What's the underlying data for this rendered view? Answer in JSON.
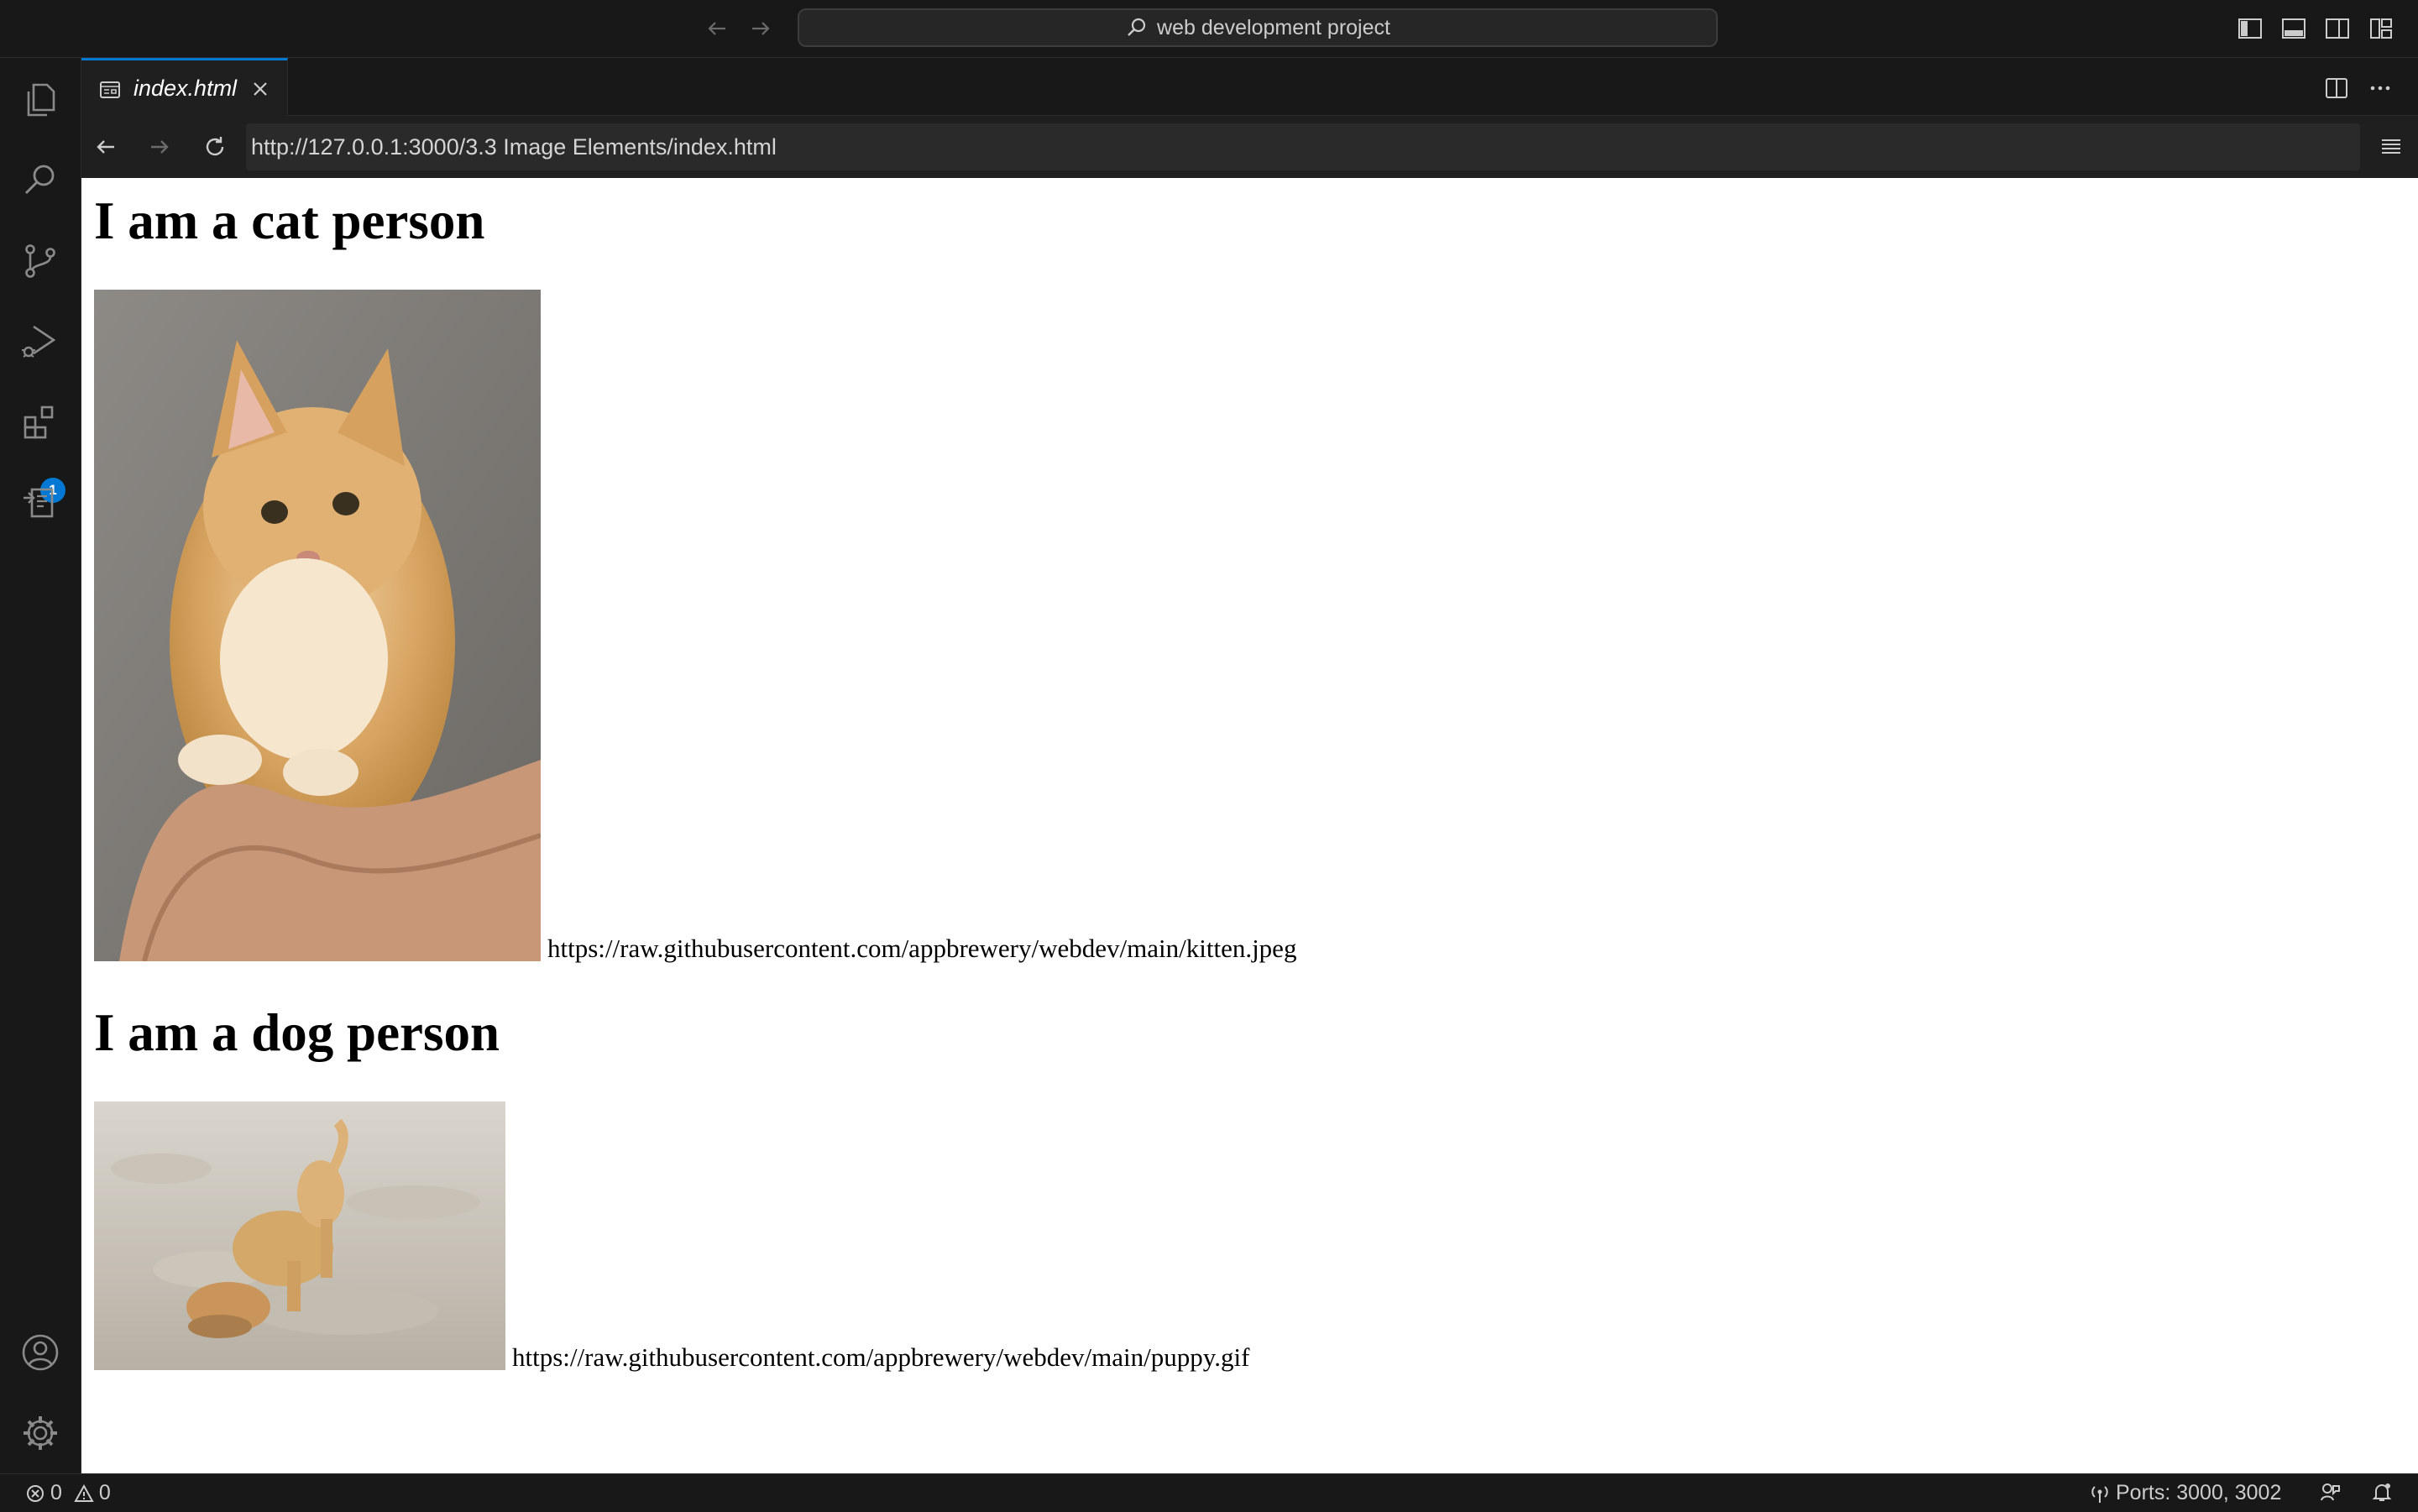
{
  "titlebar": {
    "search_label": "web development project"
  },
  "activitybar": {
    "items": [
      {
        "name": "explorer"
      },
      {
        "name": "search"
      },
      {
        "name": "source-control"
      },
      {
        "name": "run-and-debug"
      },
      {
        "name": "extensions",
        "badge": "1"
      },
      {
        "name": "remote-explorer"
      }
    ]
  },
  "tabs": [
    {
      "label": "index.html",
      "active": true
    }
  ],
  "browser": {
    "url": "http://127.0.0.1:3000/3.3 Image Elements/index.html"
  },
  "page": {
    "heading1": "I am a cat person",
    "image1_url_text": "https://raw.githubusercontent.com/appbrewery/webdev/main/kitten.jpeg",
    "heading2": "I am a dog person",
    "image2_url_text": "https://raw.githubusercontent.com/appbrewery/webdev/main/puppy.gif"
  },
  "statusbar": {
    "errors": "0",
    "warnings": "0",
    "ports": "Ports: 3000, 3002"
  },
  "colors": {
    "accent": "#0078d4",
    "chrome_bg": "#181818",
    "editor_bg": "#1f1f1f"
  }
}
